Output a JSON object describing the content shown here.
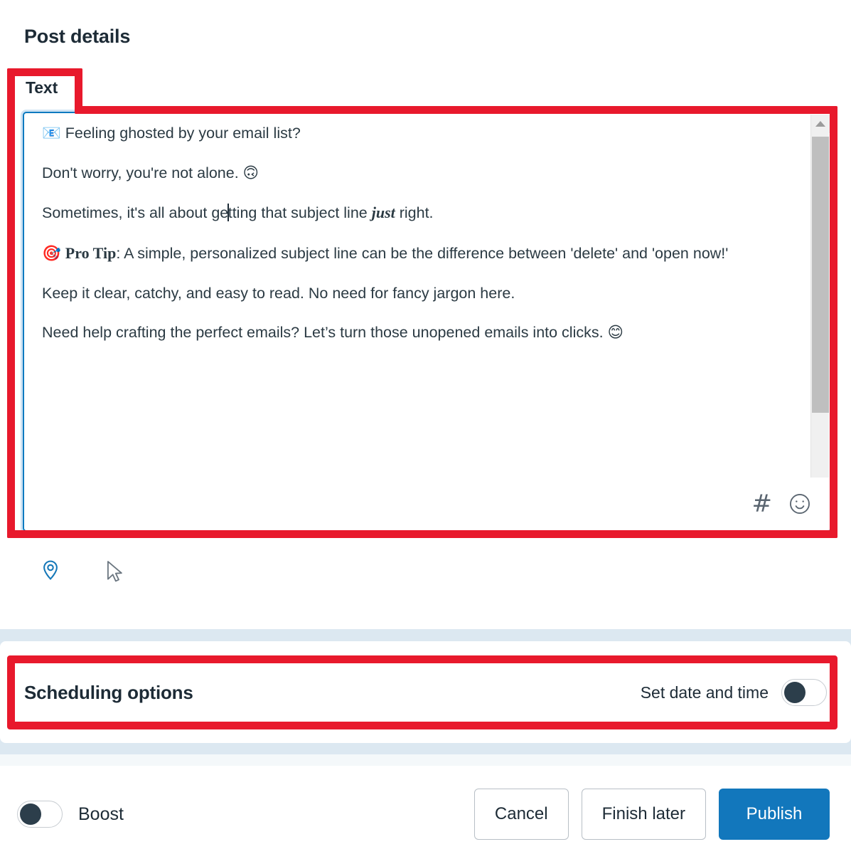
{
  "header": {
    "page_title": "Post details"
  },
  "tabs": {
    "active": "Text",
    "items": [
      "Text"
    ]
  },
  "composer": {
    "name": "post-text-editor",
    "focused": true,
    "paragraphs": [
      {
        "emoji": "📧",
        "text": " Feeling ghosted by your email list?"
      },
      {
        "emoji": "",
        "text": "Don't worry, you're not alone. 🙃"
      },
      {
        "emoji": "",
        "text": "Sometimes, it's all about getting that subject line just right."
      },
      {
        "emoji": "🎯",
        "text": " Pro Tip: A simple, personalized subject line can be the difference between 'delete' and 'open now!'"
      },
      {
        "emoji": "",
        "text": "Keep it clear, catchy, and easy to read. No need for fancy jargon here."
      },
      {
        "emoji": "",
        "text": "Need help crafting the perfect emails? Let’s turn those unopened emails into clicks. 😊"
      }
    ],
    "line1_pre": " Feeling ghosted by your email list?",
    "line2": "Don't worry, you're not alone. ",
    "line2_emoji": "🙃",
    "line3_a": "Sometimes, it's all about ge",
    "line3_b": "tting that subject line ",
    "line3_em": "just",
    "line3_c": " right.",
    "line4_emoji": "🎯",
    "line4_bold": "Pro Tip",
    "line4_rest": ": A simple, personalized subject line can be the difference between 'delete' and 'open now!'",
    "line5": "Keep it clear, catchy, and easy to read. No need for fancy jargon here.",
    "line6": "Need help crafting the perfect emails? Let’s turn those unopened emails into clicks.",
    "line6_emoji": "😊",
    "email_emoji": "📧",
    "toolbar": {
      "hashtag": "#",
      "emoji_picker": "☺"
    },
    "scrollbar": {
      "up_arrow": "▲",
      "down_arrow": "▼"
    }
  },
  "below_icons": {
    "location": "location-pin",
    "cursor": "mouse-cursor"
  },
  "scheduling": {
    "title": "Scheduling options",
    "set_date_label": "Set date and time",
    "toggle_on": false
  },
  "footer": {
    "boost_label": "Boost",
    "boost_on": false,
    "cancel_label": "Cancel",
    "finish_later_label": "Finish later",
    "publish_label": "Publish"
  },
  "colors": {
    "annotation_red": "#e8192c",
    "focus_blue": "#0a7ac0",
    "primary_blue": "#1277bc",
    "band_blue": "#dce8f1",
    "text_dark": "#1d2b36",
    "toggle_knob": "#2c3e4b"
  }
}
